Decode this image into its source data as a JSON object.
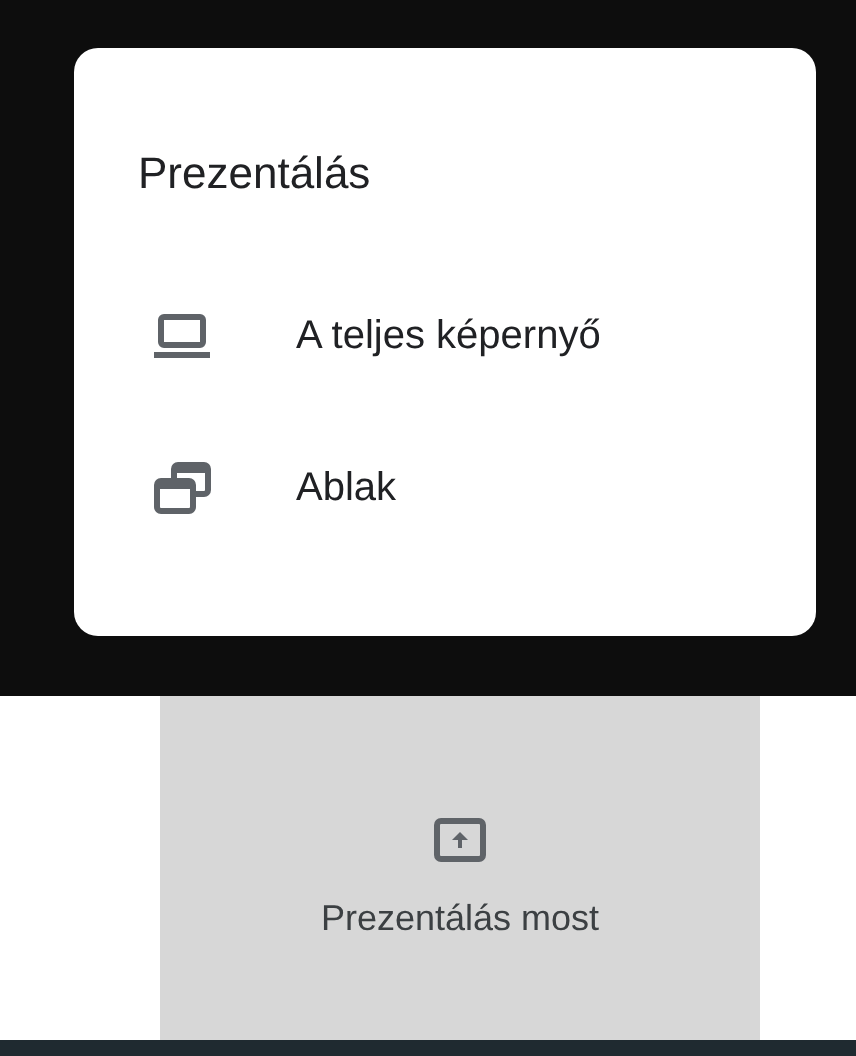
{
  "menu": {
    "title": "Prezentálás",
    "items": [
      {
        "kind": "screen",
        "label": "A teljes képernyő"
      },
      {
        "kind": "window",
        "label": "Ablak"
      }
    ]
  },
  "present_button": {
    "label": "Prezentálás most"
  }
}
